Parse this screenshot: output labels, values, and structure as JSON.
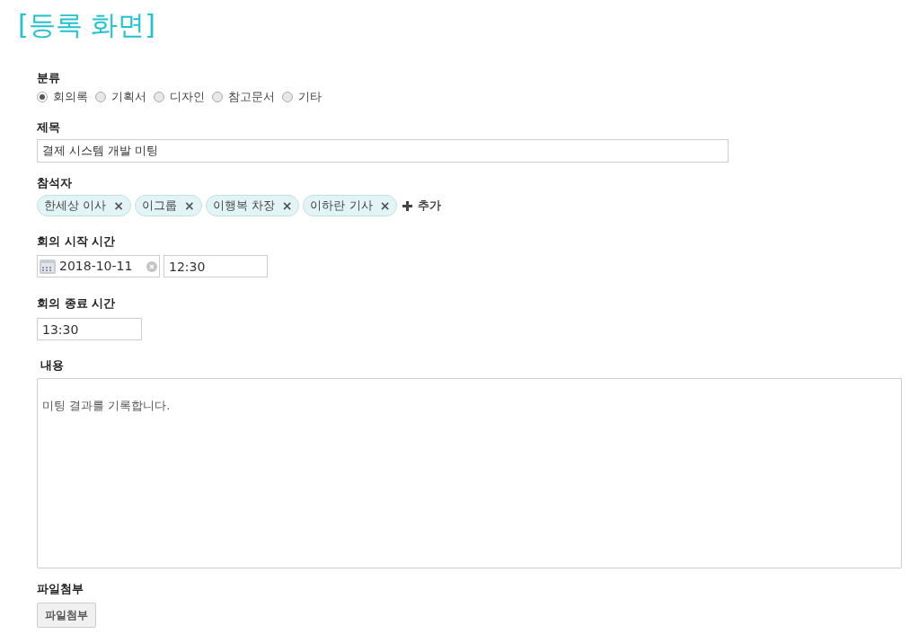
{
  "page_title": "[등록 화면]",
  "category": {
    "label": "분류",
    "options": [
      {
        "label": "회의록",
        "selected": true
      },
      {
        "label": "기획서",
        "selected": false
      },
      {
        "label": "디자인",
        "selected": false
      },
      {
        "label": "참고문서",
        "selected": false
      },
      {
        "label": "기타",
        "selected": false
      }
    ]
  },
  "title_field": {
    "label": "제목",
    "value": "결제 시스템 개발 미팅"
  },
  "attendees": {
    "label": "참석자",
    "chips": [
      {
        "label": "한세상 이사",
        "remove": "×"
      },
      {
        "label": "이그룹",
        "remove": "×"
      },
      {
        "label": "이행복 차장",
        "remove": "×"
      },
      {
        "label": "이하란 기사",
        "remove": "×"
      }
    ],
    "add_label": "추가"
  },
  "start_time": {
    "label": "회의 시작 시간",
    "date": "2018-10-11",
    "time": "12:30"
  },
  "end_time": {
    "label": "회의 종료 시간",
    "time": "13:30"
  },
  "content": {
    "label": "내용",
    "value": "미팅 결과를 기록합니다."
  },
  "attachment": {
    "label": "파일첨부",
    "button": "파일첨부"
  }
}
